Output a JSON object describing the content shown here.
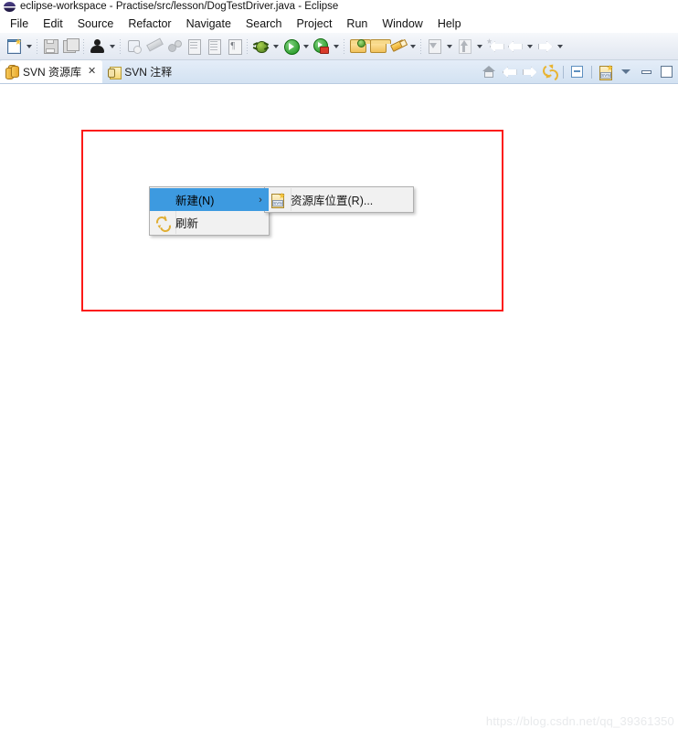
{
  "window": {
    "title": "eclipse-workspace - Practise/src/lesson/DogTestDriver.java - Eclipse",
    "app_icon": "eclipse-icon"
  },
  "menubar": {
    "items": [
      {
        "label": "File"
      },
      {
        "label": "Edit"
      },
      {
        "label": "Source"
      },
      {
        "label": "Refactor"
      },
      {
        "label": "Navigate"
      },
      {
        "label": "Search"
      },
      {
        "label": "Project"
      },
      {
        "label": "Run"
      },
      {
        "label": "Window"
      },
      {
        "label": "Help"
      }
    ]
  },
  "toolbar": {
    "items": [
      {
        "icon": "new-file-icon",
        "enabled": true,
        "dropdown": true
      },
      {
        "icon": "save-icon",
        "enabled": false,
        "dropdown": false
      },
      {
        "icon": "save-all-icon",
        "enabled": false,
        "dropdown": false
      },
      {
        "icon": "user-profile-icon",
        "enabled": true,
        "dropdown": true
      },
      {
        "icon": "toggle-mark-occurrences-icon",
        "enabled": false,
        "dropdown": false
      },
      {
        "icon": "pencil-icon",
        "enabled": false,
        "dropdown": false
      },
      {
        "icon": "link-icon",
        "enabled": false,
        "dropdown": false
      },
      {
        "icon": "document-export-icon",
        "enabled": false,
        "dropdown": false
      },
      {
        "icon": "document-lines-icon",
        "enabled": false,
        "dropdown": false
      },
      {
        "icon": "pilcrow-icon",
        "enabled": false,
        "dropdown": false
      },
      {
        "icon": "debug-icon",
        "enabled": true,
        "dropdown": true
      },
      {
        "icon": "run-icon",
        "enabled": true,
        "dropdown": true
      },
      {
        "icon": "run-coverage-icon",
        "enabled": true,
        "dropdown": true
      },
      {
        "icon": "open-folder-green-icon",
        "enabled": true,
        "dropdown": false
      },
      {
        "icon": "open-folder-icon",
        "enabled": true,
        "dropdown": false
      },
      {
        "icon": "marker-icon",
        "enabled": true,
        "dropdown": true
      },
      {
        "icon": "next-annotation-icon",
        "enabled": false,
        "dropdown": true
      },
      {
        "icon": "previous-annotation-icon",
        "enabled": false,
        "dropdown": true
      },
      {
        "icon": "back-history-icon",
        "enabled": false,
        "dropdown": false
      },
      {
        "icon": "back-icon",
        "enabled": false,
        "dropdown": true
      },
      {
        "icon": "forward-icon",
        "enabled": false,
        "dropdown": true
      }
    ]
  },
  "view_tabs": {
    "tabs": [
      {
        "label": "SVN 资源库",
        "icon": "svn-repository-icon",
        "active": true,
        "closable": true,
        "close_glyph": "✕"
      },
      {
        "label": "SVN 注释",
        "icon": "svn-annotate-icon",
        "active": false,
        "closable": false,
        "close_glyph": ""
      }
    ],
    "tools": [
      {
        "icon": "home-icon"
      },
      {
        "icon": "back-arrow-icon"
      },
      {
        "icon": "forward-arrow-icon"
      },
      {
        "icon": "refresh-icon"
      },
      {
        "icon": "collapse-all-icon"
      },
      {
        "icon": "new-repository-location-icon"
      },
      {
        "icon": "view-menu-chevron-icon"
      },
      {
        "icon": "minimize-icon"
      },
      {
        "icon": "maximize-icon"
      }
    ]
  },
  "annotation": {
    "highlight_rect_color": "#fc1a17"
  },
  "context_menu": {
    "items": [
      {
        "label": "新建(N)",
        "icon": "",
        "has_submenu": true,
        "submenu_glyph": "›",
        "selected": true
      },
      {
        "label": "刷新",
        "icon": "refresh-icon",
        "has_submenu": false,
        "submenu_glyph": "",
        "selected": false
      }
    ]
  },
  "submenu": {
    "items": [
      {
        "label": "资源库位置(R)...",
        "icon": "new-repository-location-icon"
      }
    ]
  },
  "watermark": {
    "text": "https://blog.csdn.net/qq_39361350"
  }
}
